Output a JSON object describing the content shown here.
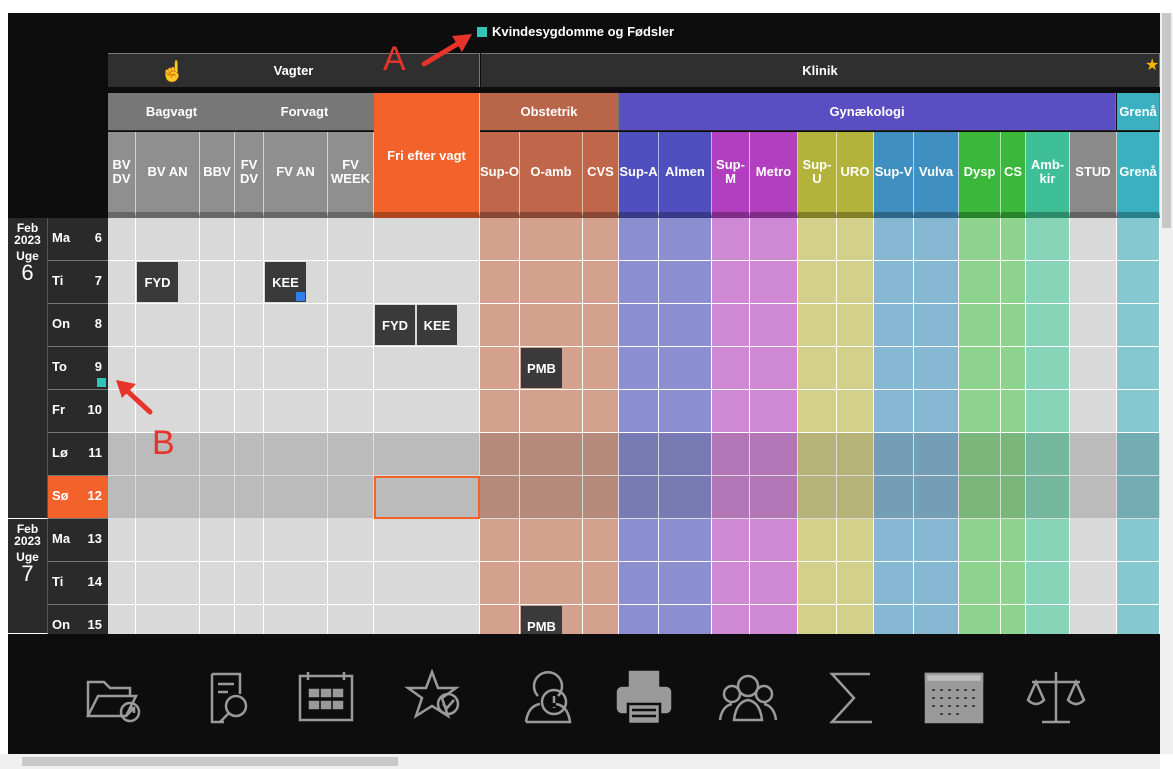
{
  "title": "Kvindesygdomme og Fødsler",
  "groups": {
    "vagter": "Vagter",
    "klinik": "Klinik"
  },
  "subgroups": [
    {
      "label": "Bagvagt",
      "color": "#777777"
    },
    {
      "label": "Forvagt",
      "color": "#777777"
    },
    {
      "label": "Fri efter vagt",
      "color": "#f2622a"
    },
    {
      "label": "Obstetrik",
      "color": "#b9654a"
    },
    {
      "label": "Gynækologi",
      "color": "#5a4ec2"
    },
    {
      "label": "Grenå",
      "color": "#3ab0c0"
    }
  ],
  "columns": [
    {
      "label": "BV DV",
      "header": "#8f8f8f",
      "cell": "#d9d9d9"
    },
    {
      "label": "BV AN",
      "header": "#8f8f8f",
      "cell": "#d9d9d9"
    },
    {
      "label": "BBV",
      "header": "#8f8f8f",
      "cell": "#d9d9d9"
    },
    {
      "label": "FV DV",
      "header": "#8f8f8f",
      "cell": "#d9d9d9"
    },
    {
      "label": "FV AN",
      "header": "#8f8f8f",
      "cell": "#d9d9d9"
    },
    {
      "label": "FV WEEK",
      "header": "#8f8f8f",
      "cell": "#d9d9d9"
    },
    {
      "label": "Fri efter vagt",
      "header": "#f2622a",
      "cell": "#d9d9d9"
    },
    {
      "label": "Sup-O",
      "header": "#c0664a",
      "cell": "#d4a18f"
    },
    {
      "label": "O-amb",
      "header": "#c0664a",
      "cell": "#d4a18f"
    },
    {
      "label": "CVS",
      "header": "#c0664a",
      "cell": "#d4a18f"
    },
    {
      "label": "Sup-A",
      "header": "#4f4fc0",
      "cell": "#8b8fd0"
    },
    {
      "label": "Almen",
      "header": "#4f4fc0",
      "cell": "#8b8fd0"
    },
    {
      "label": "Sup-M",
      "header": "#b23fc0",
      "cell": "#cf88d4"
    },
    {
      "label": "Metro",
      "header": "#b23fc0",
      "cell": "#cf88d4"
    },
    {
      "label": "Sup-U",
      "header": "#b3b23a",
      "cell": "#d2d08a"
    },
    {
      "label": "URO",
      "header": "#b3b23a",
      "cell": "#d2d08a"
    },
    {
      "label": "Sup-V",
      "header": "#3f90c0",
      "cell": "#86b8d4"
    },
    {
      "label": "Vulva",
      "header": "#3f90c0",
      "cell": "#86b8d4"
    },
    {
      "label": "Dysp",
      "header": "#3bb83b",
      "cell": "#8ed48e"
    },
    {
      "label": "CS",
      "header": "#3bb83b",
      "cell": "#8ed48e"
    },
    {
      "label": "Amb-kir",
      "header": "#3fbf95",
      "cell": "#88d4b8"
    },
    {
      "label": "STUD",
      "header": "#8a8a8a",
      "cell": "#d9d9d9"
    },
    {
      "label": "Grenå",
      "header": "#3ab0c0",
      "cell": "#86c8d0"
    }
  ],
  "weeks": [
    {
      "month": "Feb",
      "year": "2023",
      "uge": "Uge",
      "num": "6"
    },
    {
      "month": "Feb",
      "year": "2023",
      "uge": "Uge",
      "num": "7"
    }
  ],
  "days": [
    {
      "name": "Ma",
      "num": "6",
      "type": "normal"
    },
    {
      "name": "Ti",
      "num": "7",
      "type": "normal"
    },
    {
      "name": "On",
      "num": "8",
      "type": "normal"
    },
    {
      "name": "To",
      "num": "9",
      "type": "normal",
      "marker": true
    },
    {
      "name": "Fr",
      "num": "10",
      "type": "normal"
    },
    {
      "name": "Lø",
      "num": "11",
      "type": "weekend"
    },
    {
      "name": "Sø",
      "num": "12",
      "type": "today"
    },
    {
      "name": "Ma",
      "num": "13",
      "type": "normal"
    },
    {
      "name": "Ti",
      "num": "14",
      "type": "normal"
    },
    {
      "name": "On",
      "num": "15",
      "type": "normal"
    }
  ],
  "assignments": [
    {
      "text": "FYD",
      "row": 1,
      "col": 1
    },
    {
      "text": "KEE",
      "row": 1,
      "col": 4,
      "marker": true
    },
    {
      "text": "FYD",
      "row": 2,
      "col": 6,
      "half": "left"
    },
    {
      "text": "KEE",
      "row": 2,
      "col": 6,
      "half": "right"
    },
    {
      "text": "PMB",
      "row": 3,
      "col": 8
    },
    {
      "text": "PMB",
      "row": 9,
      "col": 8
    }
  ],
  "annotations": {
    "a": "A",
    "b": "B"
  },
  "toolbar": [
    "open-folder-icon",
    "search-document-icon",
    "calendar-icon",
    "favorite-star-icon",
    "alert-user-icon",
    "print-icon",
    "group-users-icon",
    "sum-icon",
    "keyboard-calendar-icon",
    "balance-scale-icon"
  ],
  "colors": {
    "marker": "#2ec4b6",
    "today": "#f2622a",
    "markerBlue": "#2f80ed"
  }
}
